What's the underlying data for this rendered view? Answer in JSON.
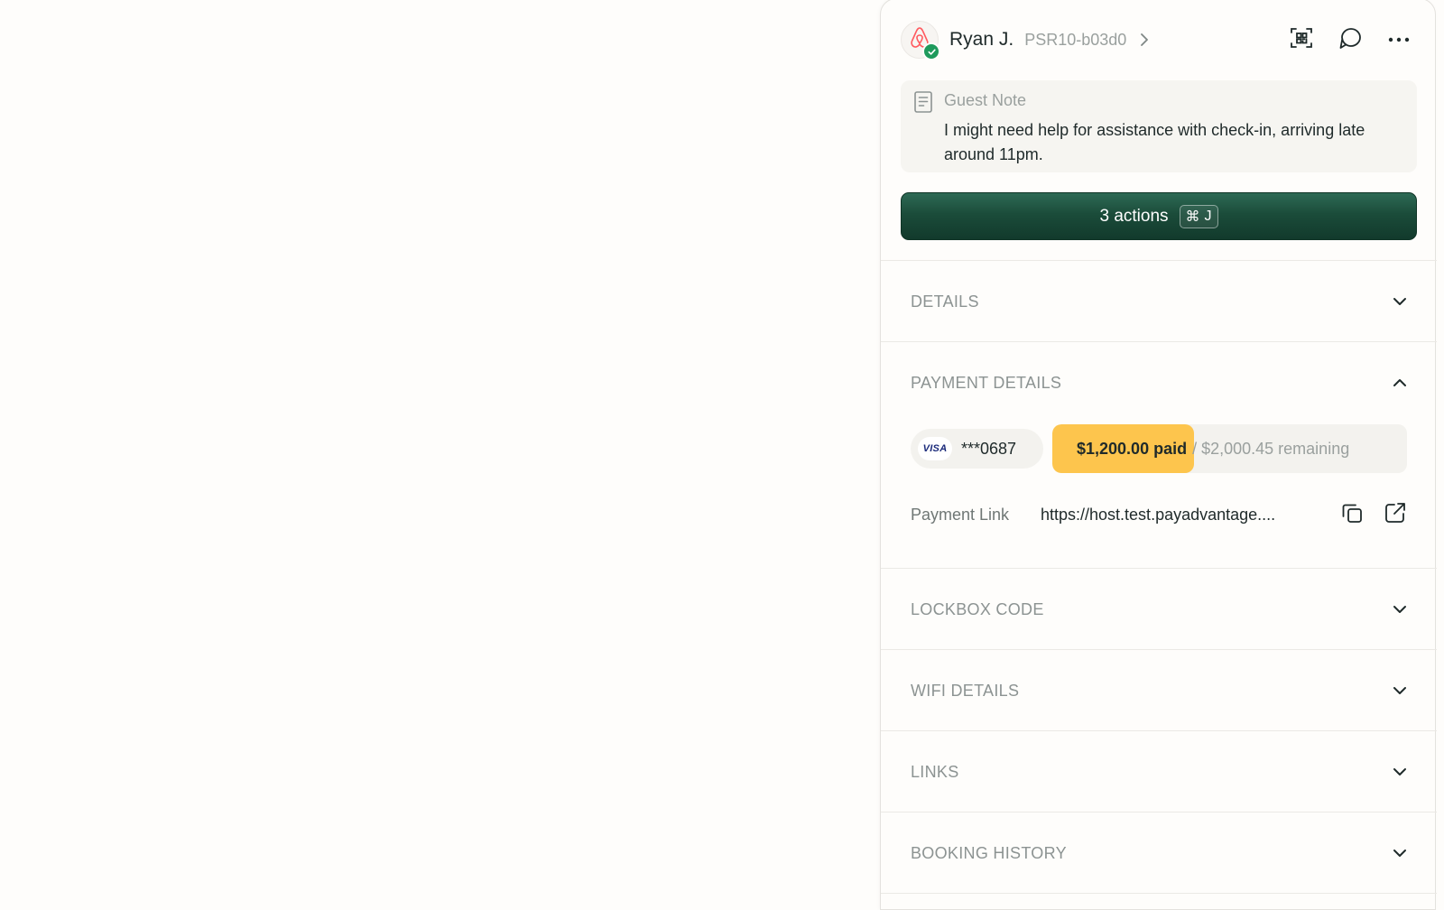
{
  "header": {
    "guest_name": "Ryan J.",
    "reservation_code": "PSR10-b03d0",
    "icons": [
      "airbnb-logo-icon",
      "verified-check-icon",
      "chevron-right-icon",
      "scan-icon",
      "chat-icon",
      "more-icon"
    ]
  },
  "guest_note": {
    "title": "Guest Note",
    "text": "I might need help for assistance with check-in, arriving late around 11pm."
  },
  "actions": {
    "label": "3 actions",
    "shortcut_symbol": "⌘",
    "shortcut_key": "J"
  },
  "sections": {
    "details": "DETAILS",
    "payment_details": "PAYMENT DETAILS",
    "lockbox_code": "LOCKBOX CODE",
    "wifi_details": "WIFI DETAILS",
    "links": "LINKS",
    "booking_history": "BOOKING HISTORY"
  },
  "payment": {
    "card_brand": "VISA",
    "card_digits": "***0687",
    "paid_label": "$1,200.00 paid",
    "remaining_label": "/ $2,000.45 remaining",
    "paid_fraction": 0.4,
    "link_label": "Payment Link",
    "link_url": "https://host.test.payadvantage...."
  },
  "colors": {
    "accent_dark_green": "#1b4c3a",
    "progress_fill": "#fdc54d",
    "verified_green": "#1e9a5c",
    "airbnb_red": "#ff5a5f"
  }
}
